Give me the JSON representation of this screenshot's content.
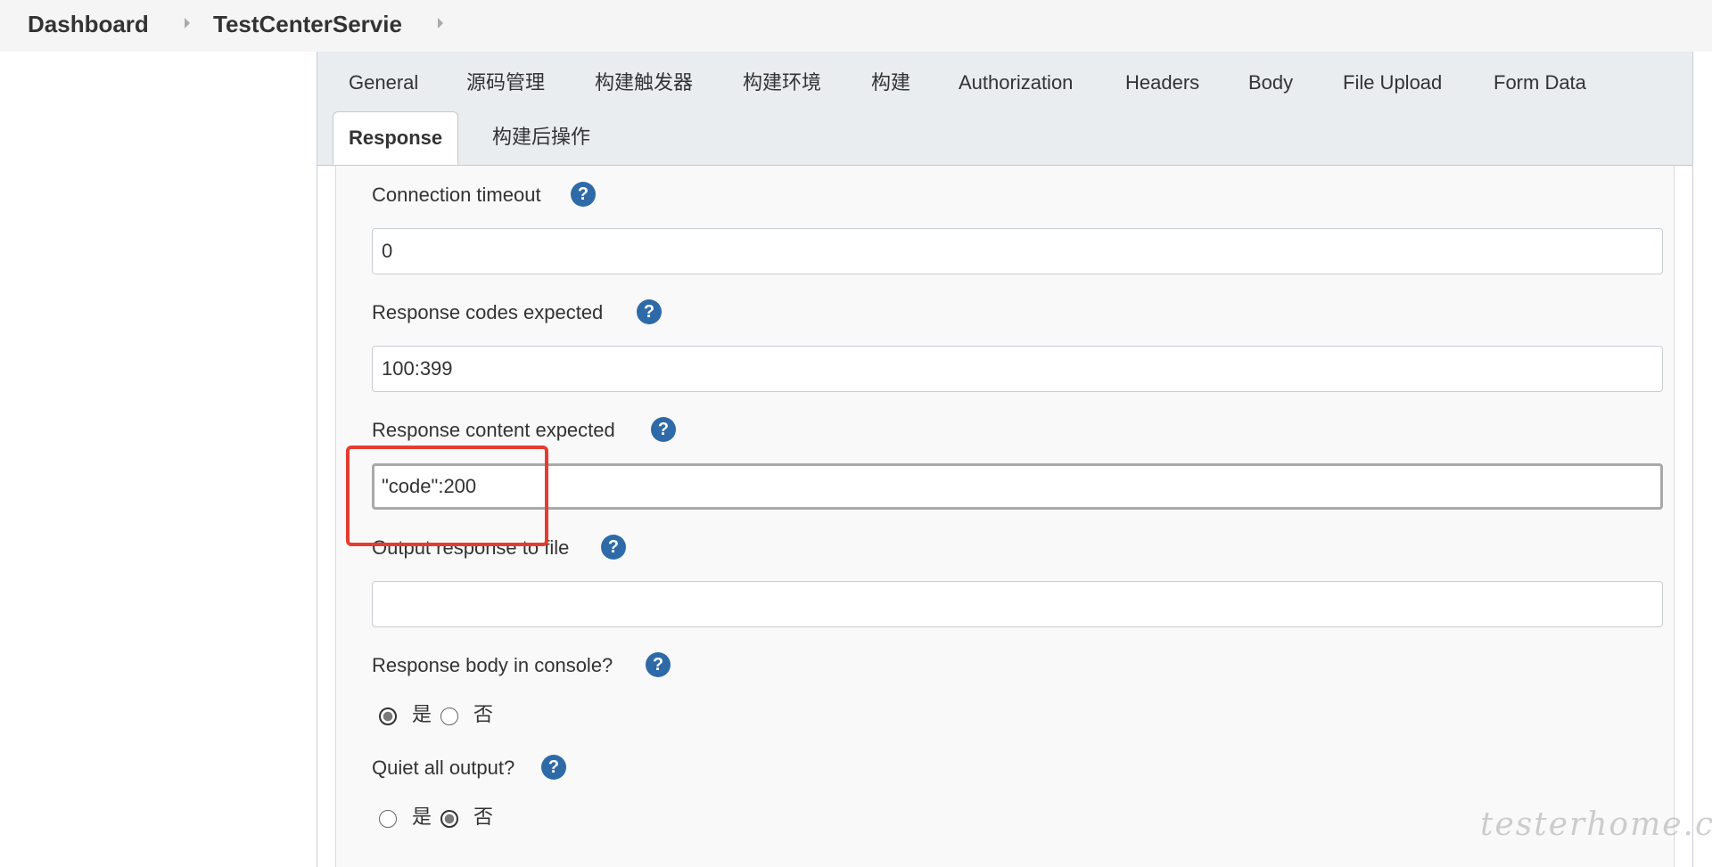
{
  "breadcrumb": {
    "items": [
      "Dashboard",
      "TestCenterServie"
    ]
  },
  "tabs": {
    "row1": [
      "General",
      "源码管理",
      "构建触发器",
      "构建环境",
      "构建",
      "Authorization",
      "Headers",
      "Body",
      "File Upload",
      "Form Data"
    ],
    "row2": [
      "Response",
      "构建后操作"
    ],
    "active": "Response"
  },
  "form": {
    "connection_timeout": {
      "label": "Connection timeout",
      "value": "0"
    },
    "response_codes": {
      "label": "Response codes expected",
      "value": "100:399"
    },
    "response_content": {
      "label": "Response content expected",
      "value": "\"code\":200"
    },
    "output_file": {
      "label": "Output response to file",
      "value": ""
    },
    "body_in_console": {
      "label": "Response body in console?",
      "options": [
        "是",
        "否"
      ],
      "selected": "是"
    },
    "quiet_output": {
      "label": "Quiet all output?",
      "options": [
        "是",
        "否"
      ],
      "selected": "否"
    },
    "help_glyph": "?"
  },
  "icons": {
    "help": "question-circle-icon",
    "breadcrumb_separator": "caret-right-icon",
    "help_color": "#2f6aa8",
    "highlight_color": "#e53c2f"
  },
  "watermark": "testerhome.com"
}
